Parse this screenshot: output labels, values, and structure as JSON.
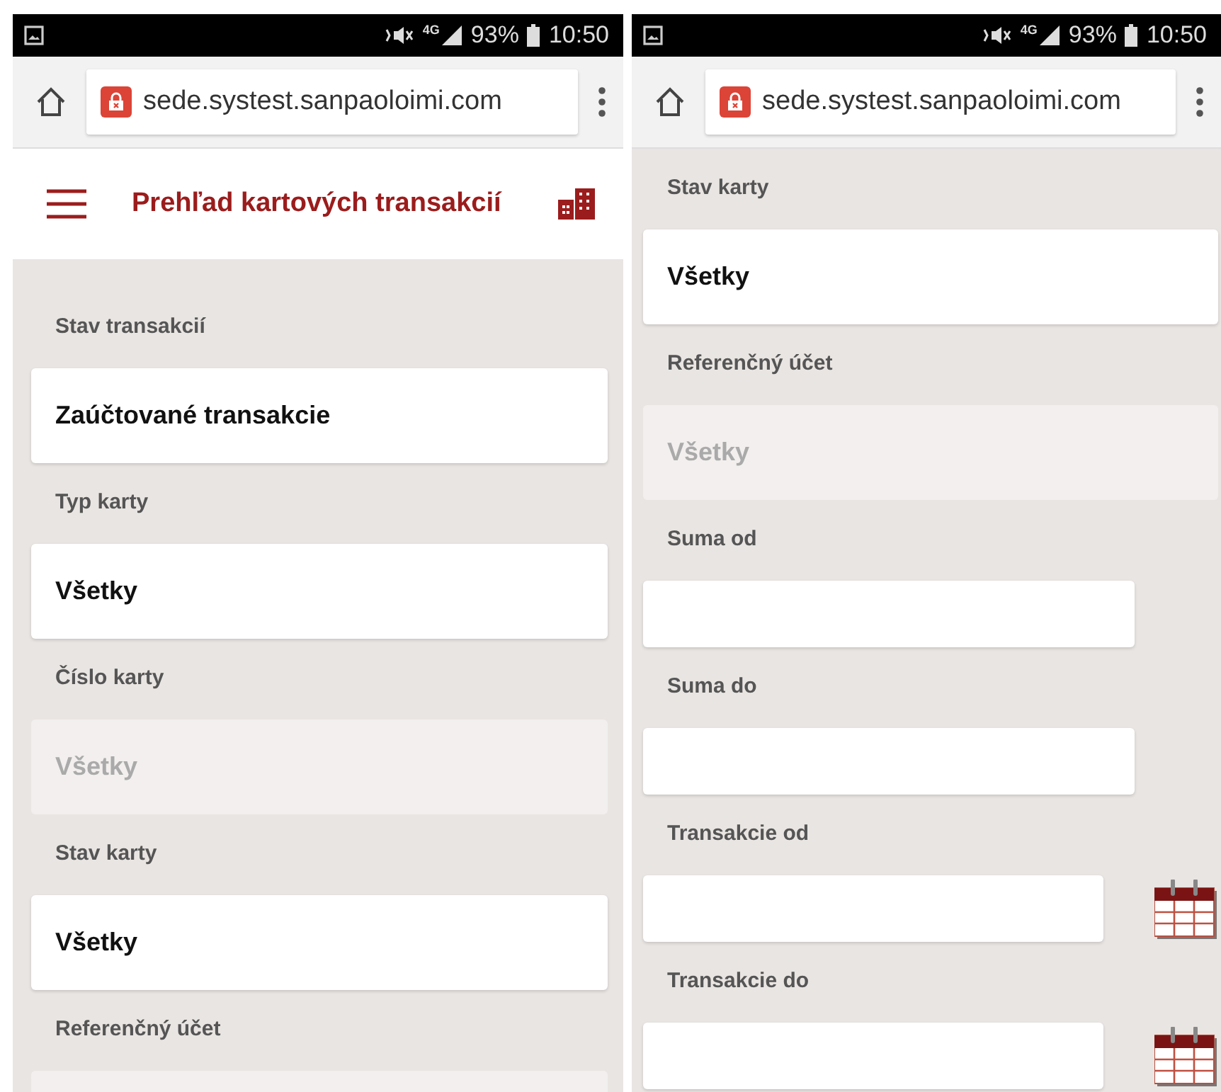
{
  "screens": [
    {
      "status_bar": {
        "network": "4G",
        "battery": "93%",
        "time": "10:50"
      },
      "address_bar": {
        "url": "sede.systest.sanpaoloimi.com"
      },
      "header": {
        "title": "Prehľad kartových transakcií"
      },
      "fields": [
        {
          "kind": "select",
          "label": "Stav transakcií",
          "value": "Zaúčtované transakcie",
          "disabled": false
        },
        {
          "kind": "select",
          "label": "Typ karty",
          "value": "Všetky",
          "disabled": false
        },
        {
          "kind": "select",
          "label": "Číslo karty",
          "value": "Všetky",
          "disabled": true
        },
        {
          "kind": "select",
          "label": "Stav karty",
          "value": "Všetky",
          "disabled": false
        },
        {
          "kind": "select",
          "label": "Referenčný účet",
          "disabled": true
        }
      ]
    },
    {
      "status_bar": {
        "network": "4G",
        "battery": "93%",
        "time": "10:50"
      },
      "address_bar": {
        "url": "sede.systest.sanpaoloimi.com"
      },
      "fields": [
        {
          "kind": "select",
          "label": "Stav karty",
          "value": "Všetky",
          "disabled": false
        },
        {
          "kind": "select",
          "label": "Referenčný účet",
          "value": "Všetky",
          "disabled": true
        },
        {
          "kind": "input",
          "label": "Suma od",
          "disabled": false
        },
        {
          "kind": "input",
          "label": "Suma do",
          "disabled": false
        },
        {
          "kind": "date",
          "label": "Transakcie od",
          "disabled": false
        },
        {
          "kind": "date",
          "label": "Transakcie do",
          "disabled": false
        }
      ]
    }
  ]
}
